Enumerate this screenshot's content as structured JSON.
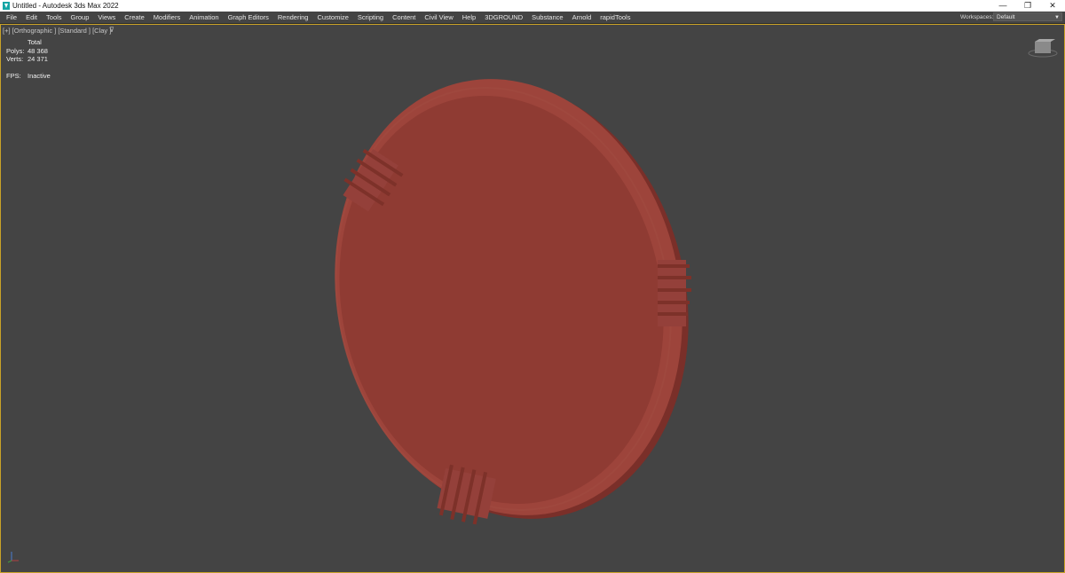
{
  "window": {
    "title": "Untitled - Autodesk 3ds Max 2022",
    "controls": {
      "minimize": "—",
      "restore": "❐",
      "close": "✕"
    }
  },
  "menubar": {
    "items": [
      "File",
      "Edit",
      "Tools",
      "Group",
      "Views",
      "Create",
      "Modifiers",
      "Animation",
      "Graph Editors",
      "Rendering",
      "Customize",
      "Scripting",
      "Content",
      "Civil View",
      "Help",
      "3DGROUND",
      "Substance",
      "Arnold",
      "rapidTools"
    ]
  },
  "workspaces": {
    "label": "Workspaces:",
    "value": "Default"
  },
  "viewport": {
    "label": "[+] [Orthographic ] [Standard ] [Clay ]",
    "stats": {
      "header": "Total",
      "polys_label": "Polys:",
      "polys_value": "48 368",
      "verts_label": "Verts:",
      "verts_value": "24 371",
      "fps_label": "FPS:",
      "fps_value": "Inactive"
    }
  },
  "colors": {
    "object": "#8f3b33",
    "object_rim": "#9d443b",
    "viewport_bg": "#444444",
    "active_border": "#c9a227"
  },
  "icons": {
    "app": "3ds-max-icon",
    "filter": "filter-icon",
    "viewcube": "viewcube-icon",
    "axis": "axis-tripod-icon"
  }
}
